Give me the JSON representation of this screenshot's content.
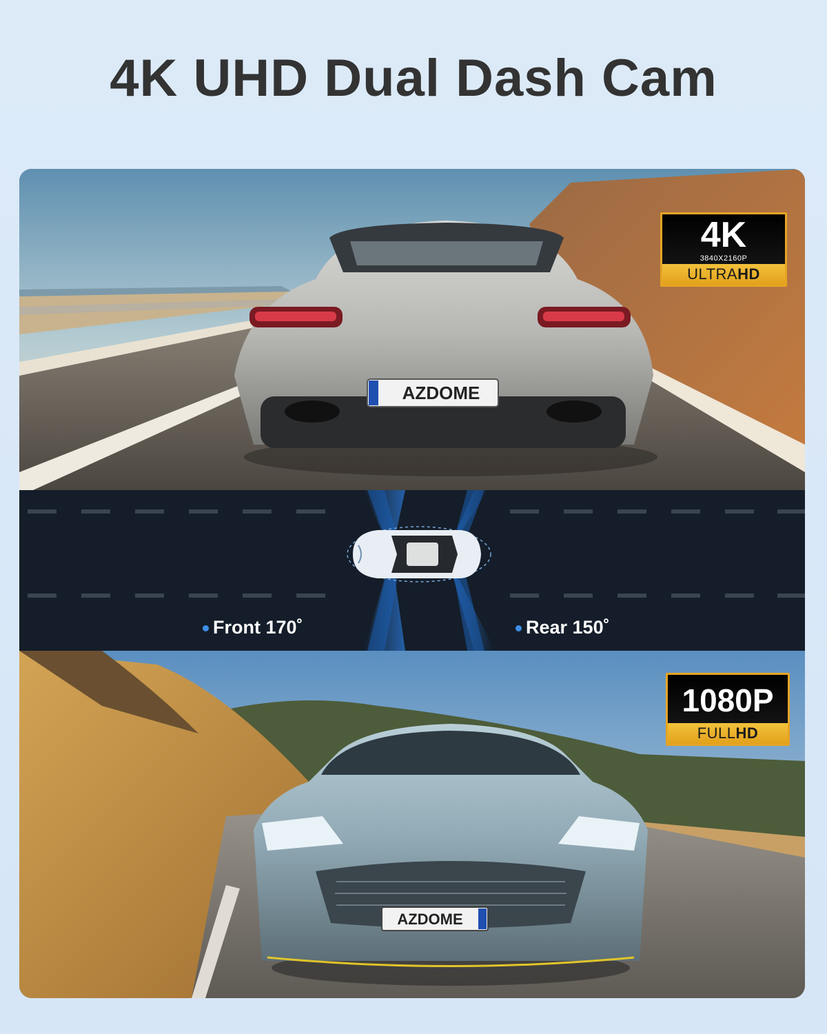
{
  "title": "4K UHD Dual Dash Cam",
  "front_panel": {
    "plate_text": "AZDOME",
    "badge": {
      "big": "4K",
      "resolution": "3840X2160P",
      "strip_left": "ULTRA",
      "strip_right": "HD"
    }
  },
  "diagram": {
    "front_label": "Front 170˚",
    "rear_label": "Rear 150˚",
    "icon": "car-top-view-icon"
  },
  "rear_panel": {
    "plate_text": "AZDOME",
    "badge": {
      "big": "1080P",
      "strip_left": "FULL",
      "strip_right": "HD"
    }
  },
  "colors": {
    "background": "#d6e6f7",
    "badge_gold": "#e6a423",
    "diagram_bg": "#141d29",
    "accent_blue": "#3d8fe6"
  }
}
